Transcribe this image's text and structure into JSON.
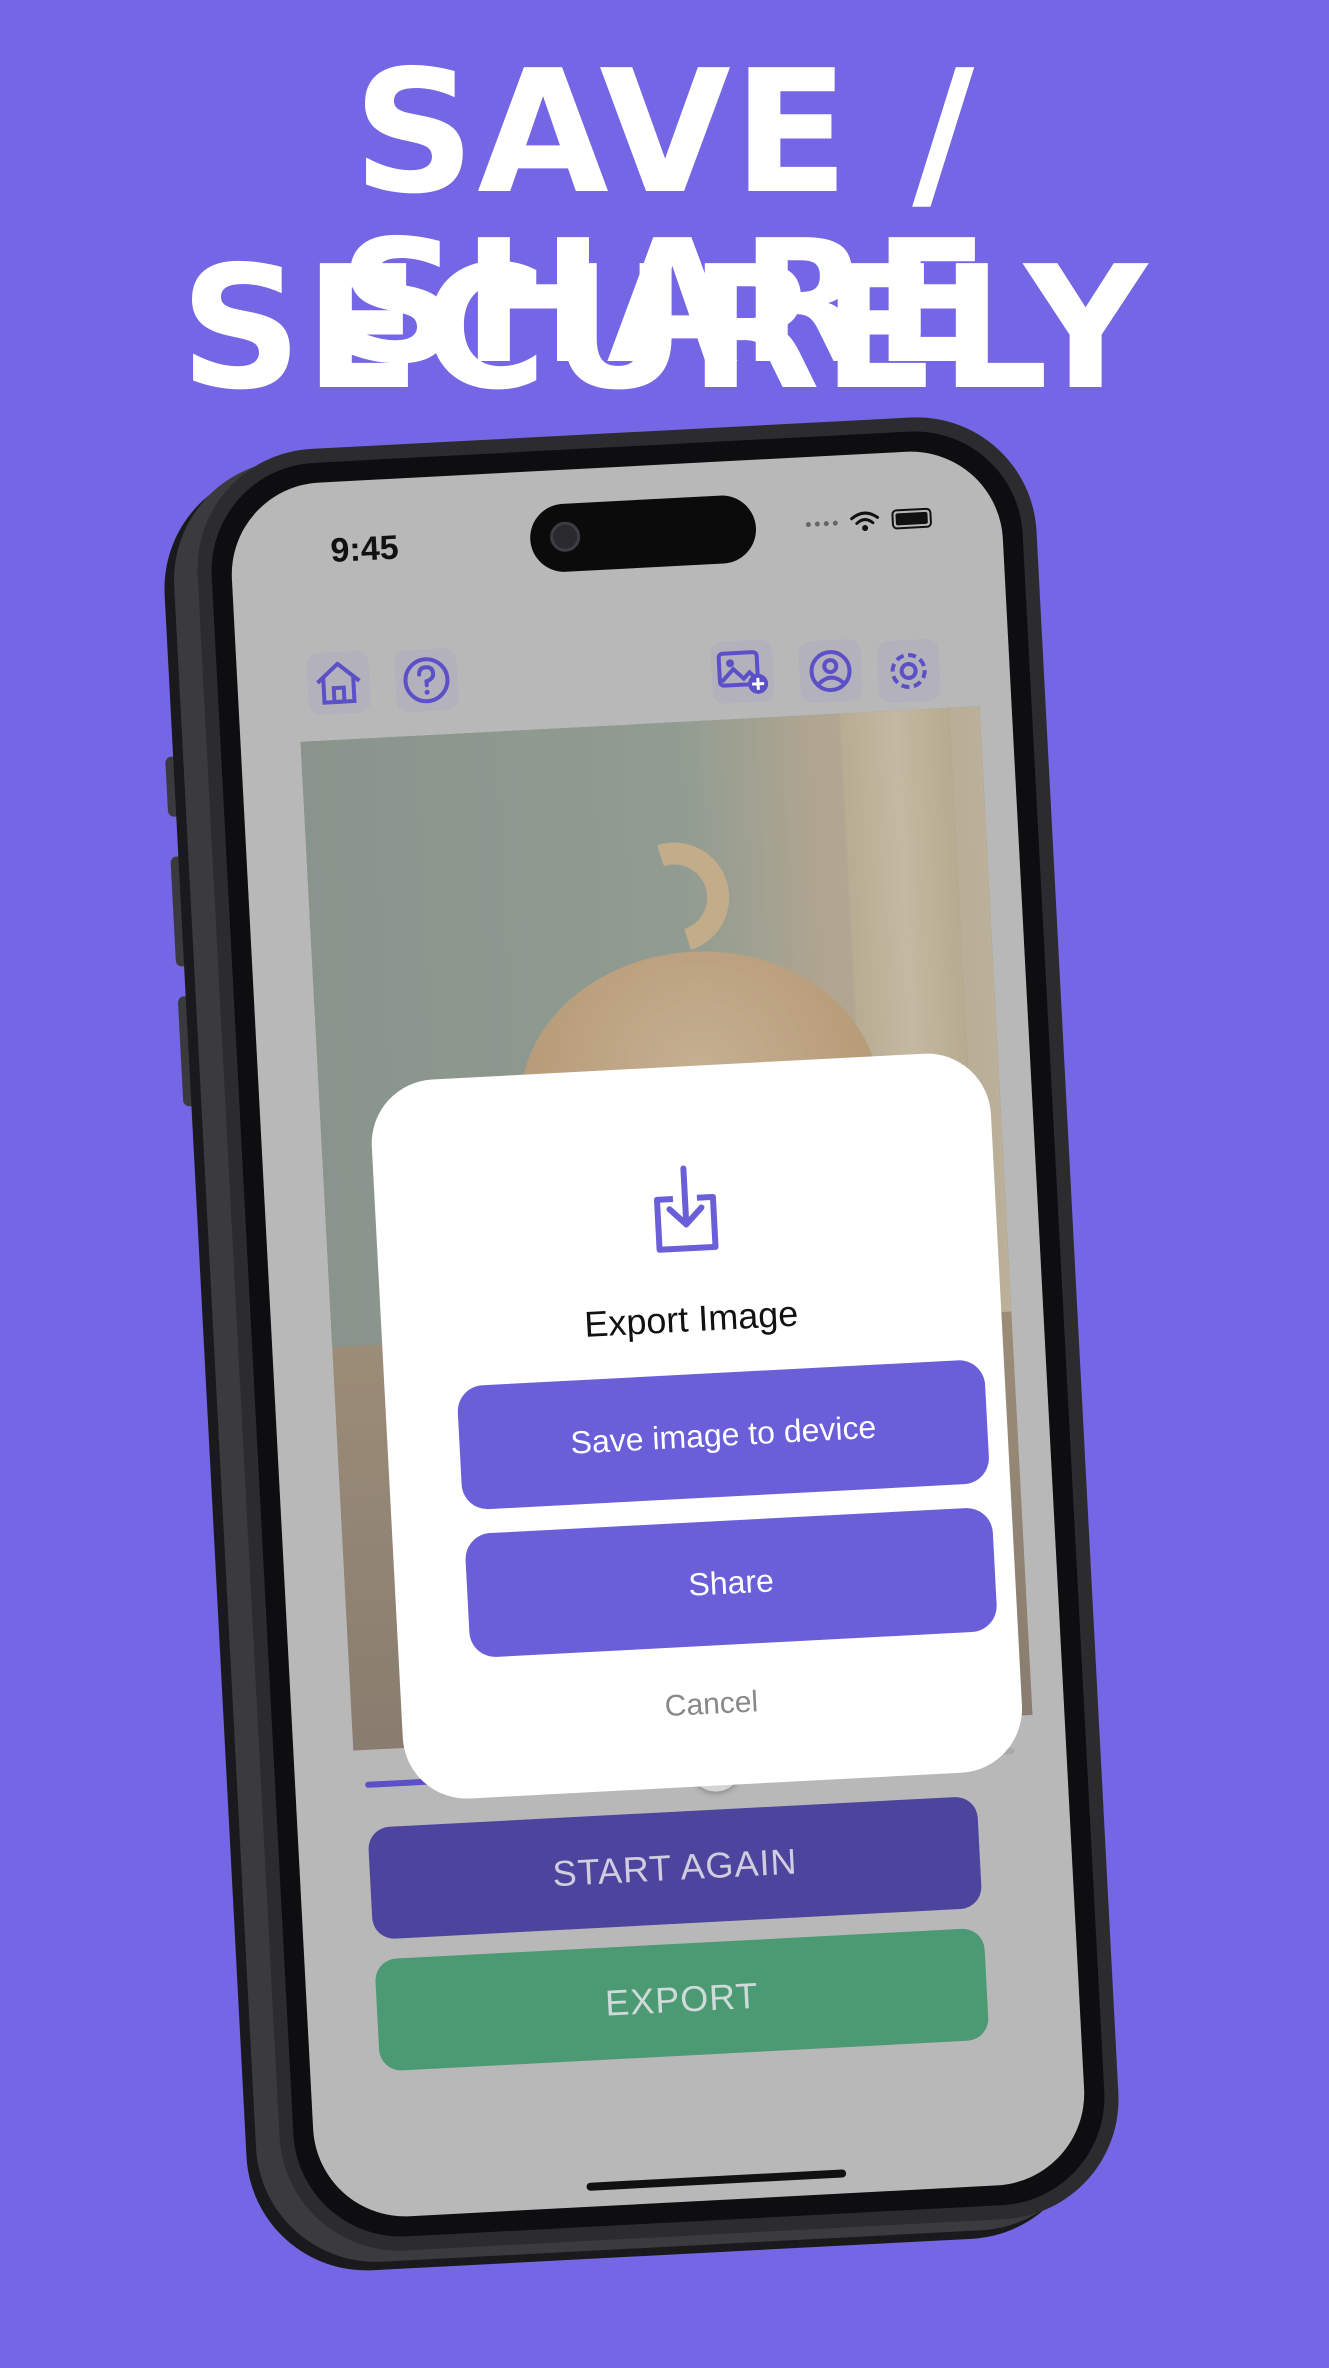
{
  "headline": {
    "line1": "SAVE / SHARE",
    "line2": "SECURELY"
  },
  "status_bar": {
    "time": "9:45"
  },
  "toolbar": {
    "icons": [
      "home-icon",
      "help-icon",
      "add-image-icon",
      "profile-icon",
      "settings-icon"
    ]
  },
  "slider": {
    "value": 0.54
  },
  "buttons": {
    "start_again": "START AGAIN",
    "export": "EXPORT"
  },
  "modal": {
    "icon": "download-icon",
    "title": "Export Image",
    "save_label": "Save image to device",
    "share_label": "Share",
    "cancel_label": "Cancel"
  },
  "colors": {
    "background": "#7466e4",
    "accent": "#6a5fd9",
    "start_again_bg": "#4d459d",
    "export_bg": "#4b9a73"
  }
}
